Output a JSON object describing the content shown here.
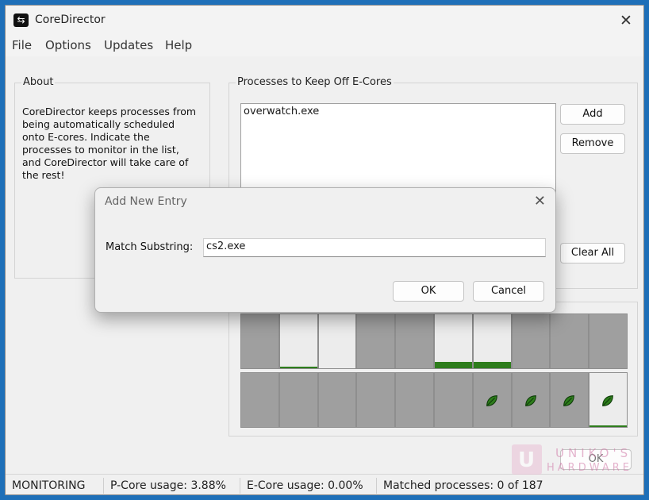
{
  "window": {
    "title": "CoreDirector",
    "close_glyph": "✕"
  },
  "menu": {
    "items": [
      "File",
      "Options",
      "Updates",
      "Help"
    ]
  },
  "about": {
    "heading": "About",
    "text": "CoreDirector keeps processes from being automatically scheduled onto E-cores. Indicate the processes to monitor in the list, and CoreDirector will take care of the rest!"
  },
  "processes": {
    "heading": "Processes to Keep Off E-Cores",
    "items": [
      "overwatch.exe"
    ],
    "add_label": "Add",
    "remove_label": "Remove",
    "clear_all_label": "Clear All"
  },
  "cores": {
    "p_cores_usage": [
      0,
      0.03,
      0,
      0,
      0,
      0.12,
      0.12,
      0,
      0,
      0
    ],
    "p_cores_light": [
      false,
      true,
      true,
      false,
      false,
      true,
      true,
      false,
      false,
      false
    ],
    "e_cores_leaf": [
      false,
      false,
      false,
      false,
      false,
      false,
      true,
      true,
      true,
      true
    ],
    "e_cores_light": [
      false,
      false,
      false,
      false,
      false,
      false,
      false,
      false,
      false,
      true
    ],
    "e_cores_usage": [
      0,
      0,
      0,
      0,
      0,
      0,
      0,
      0,
      0,
      0.03
    ],
    "leaf_color": "#2e7d1c"
  },
  "ok_button_hidden_label": "OK",
  "status": {
    "mode": "MONITORING",
    "p_core": "P-Core usage: 3.88%",
    "e_core": "E-Core usage: 0.00%",
    "matched": "Matched processes: 0 of 187"
  },
  "dialog": {
    "title": "Add New Entry",
    "close_glyph": "✕",
    "label": "Match Substring:",
    "value": "cs2.exe",
    "ok_label": "OK",
    "cancel_label": "Cancel"
  },
  "watermark": {
    "line1": "UNIKO'S",
    "line2": "HARDWARE",
    "logo_letter": "U"
  }
}
